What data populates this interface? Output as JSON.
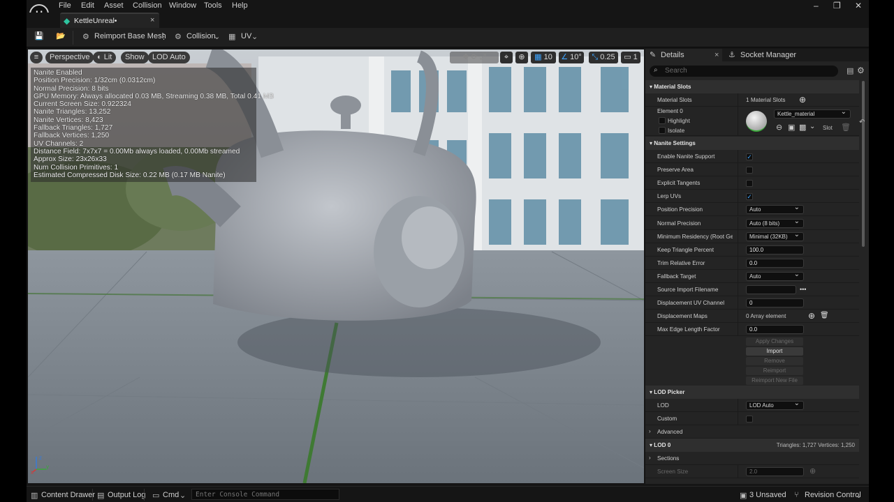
{
  "menu": {
    "items": [
      "File",
      "Edit",
      "Asset",
      "Collision",
      "Window",
      "Tools",
      "Help"
    ]
  },
  "window": {
    "minimize": "–",
    "restore": "❐",
    "close": "✕"
  },
  "tab": {
    "title": "KettleUnreal•",
    "close": "×"
  },
  "toolbar": {
    "save": "💾",
    "browse": "📂",
    "reimport": "Reimport Base Mesh",
    "collision": "Collision",
    "uv": "UV"
  },
  "viewport": {
    "menu_icon": "≡",
    "perspective": "Perspective",
    "lit": "Lit",
    "show": "Show",
    "lod": "LOD Auto",
    "grid_snap": "10",
    "angle_snap": "10°",
    "scale_snap": "0.25",
    "camera_speed": "1",
    "stats": [
      "Nanite Enabled",
      "Position Precision: 1/32cm (0.0312cm)",
      "Normal Precision: 8 bits",
      "GPU Memory: Always allocated 0.03 MB, Streaming 0.38 MB, Total 0.41 MB",
      "Current Screen Size:  0.922324",
      "Nanite Triangles:  13,252",
      "Nanite Vertices:  8,423",
      "Fallback Triangles:  1,727",
      "Fallback Vertices:  1,250",
      "UV Channels:  2",
      "Distance Field:  7x7x7 = 0.00Mb always loaded, 0.00Mb streamed",
      "Approx Size: 23x26x33",
      "Num Collision Primitives:  1",
      "Estimated Compressed Disk Size: 0.22 MB (0.17 MB Nanite)"
    ]
  },
  "details": {
    "tab_details": "Details",
    "tab_close": "×",
    "tab_socket": "Socket Manager",
    "search_placeholder": "Search",
    "material_slots_section": "Material Slots",
    "material_slots_label": "Material Slots",
    "material_slots_value": "1 Material Slots",
    "element_label": "Element 0",
    "highlight": "Highlight",
    "isolate": "Isolate",
    "material_name": "Kettle_material",
    "slot": "Slot",
    "nanite_section": "Nanite Settings",
    "rows": [
      {
        "label": "Enable Nanite Support",
        "type": "check",
        "checked": true
      },
      {
        "label": "Preserve Area",
        "type": "check",
        "checked": false
      },
      {
        "label": "Explicit Tangents",
        "type": "check",
        "checked": false
      },
      {
        "label": "Lerp UVs",
        "type": "check",
        "checked": true
      },
      {
        "label": "Position Precision",
        "type": "combo",
        "value": "Auto"
      },
      {
        "label": "Normal Precision",
        "type": "combo",
        "value": "Auto (8 bits)"
      },
      {
        "label": "Minimum Residency (Root Geom",
        "type": "combo",
        "value": "Minimal (32KB)"
      },
      {
        "label": "Keep Triangle Percent",
        "type": "num",
        "value": "100.0"
      },
      {
        "label": "Trim Relative Error",
        "type": "num",
        "value": "0.0"
      },
      {
        "label": "Fallback Target",
        "type": "combo",
        "value": "Auto"
      },
      {
        "label": "Source Import Filename",
        "type": "text",
        "value": ""
      },
      {
        "label": "Displacement UV Channel",
        "type": "num",
        "value": "0"
      },
      {
        "label": "Displacement Maps",
        "type": "array",
        "value": "0 Array element"
      },
      {
        "label": "Max Edge Length Factor",
        "type": "num",
        "value": "0.0"
      }
    ],
    "buttons": [
      "Apply Changes",
      "Import",
      "Remove",
      "Reimport",
      "Reimport New File"
    ],
    "lod_picker_section": "LOD Picker",
    "lod_label": "LOD",
    "lod_value": "LOD Auto",
    "custom_label": "Custom",
    "advanced_label": "Advanced",
    "lod0_section": "LOD 0",
    "lod0_stats": "Triangles: 1,727    Vertices: 1,250",
    "sections_label": "Sections",
    "screen_size_label": "Screen Size",
    "screen_size_value": "2.0"
  },
  "statusbar": {
    "content_drawer": "Content Drawer",
    "output_log": "Output Log",
    "cmd": "Cmd",
    "console_placeholder": "Enter Console Command",
    "unsaved": "3 Unsaved",
    "revision_control": "Revision Control"
  },
  "colors": {
    "accent": "#3ea5ff",
    "panel": "#242424",
    "frame": "#151515"
  }
}
